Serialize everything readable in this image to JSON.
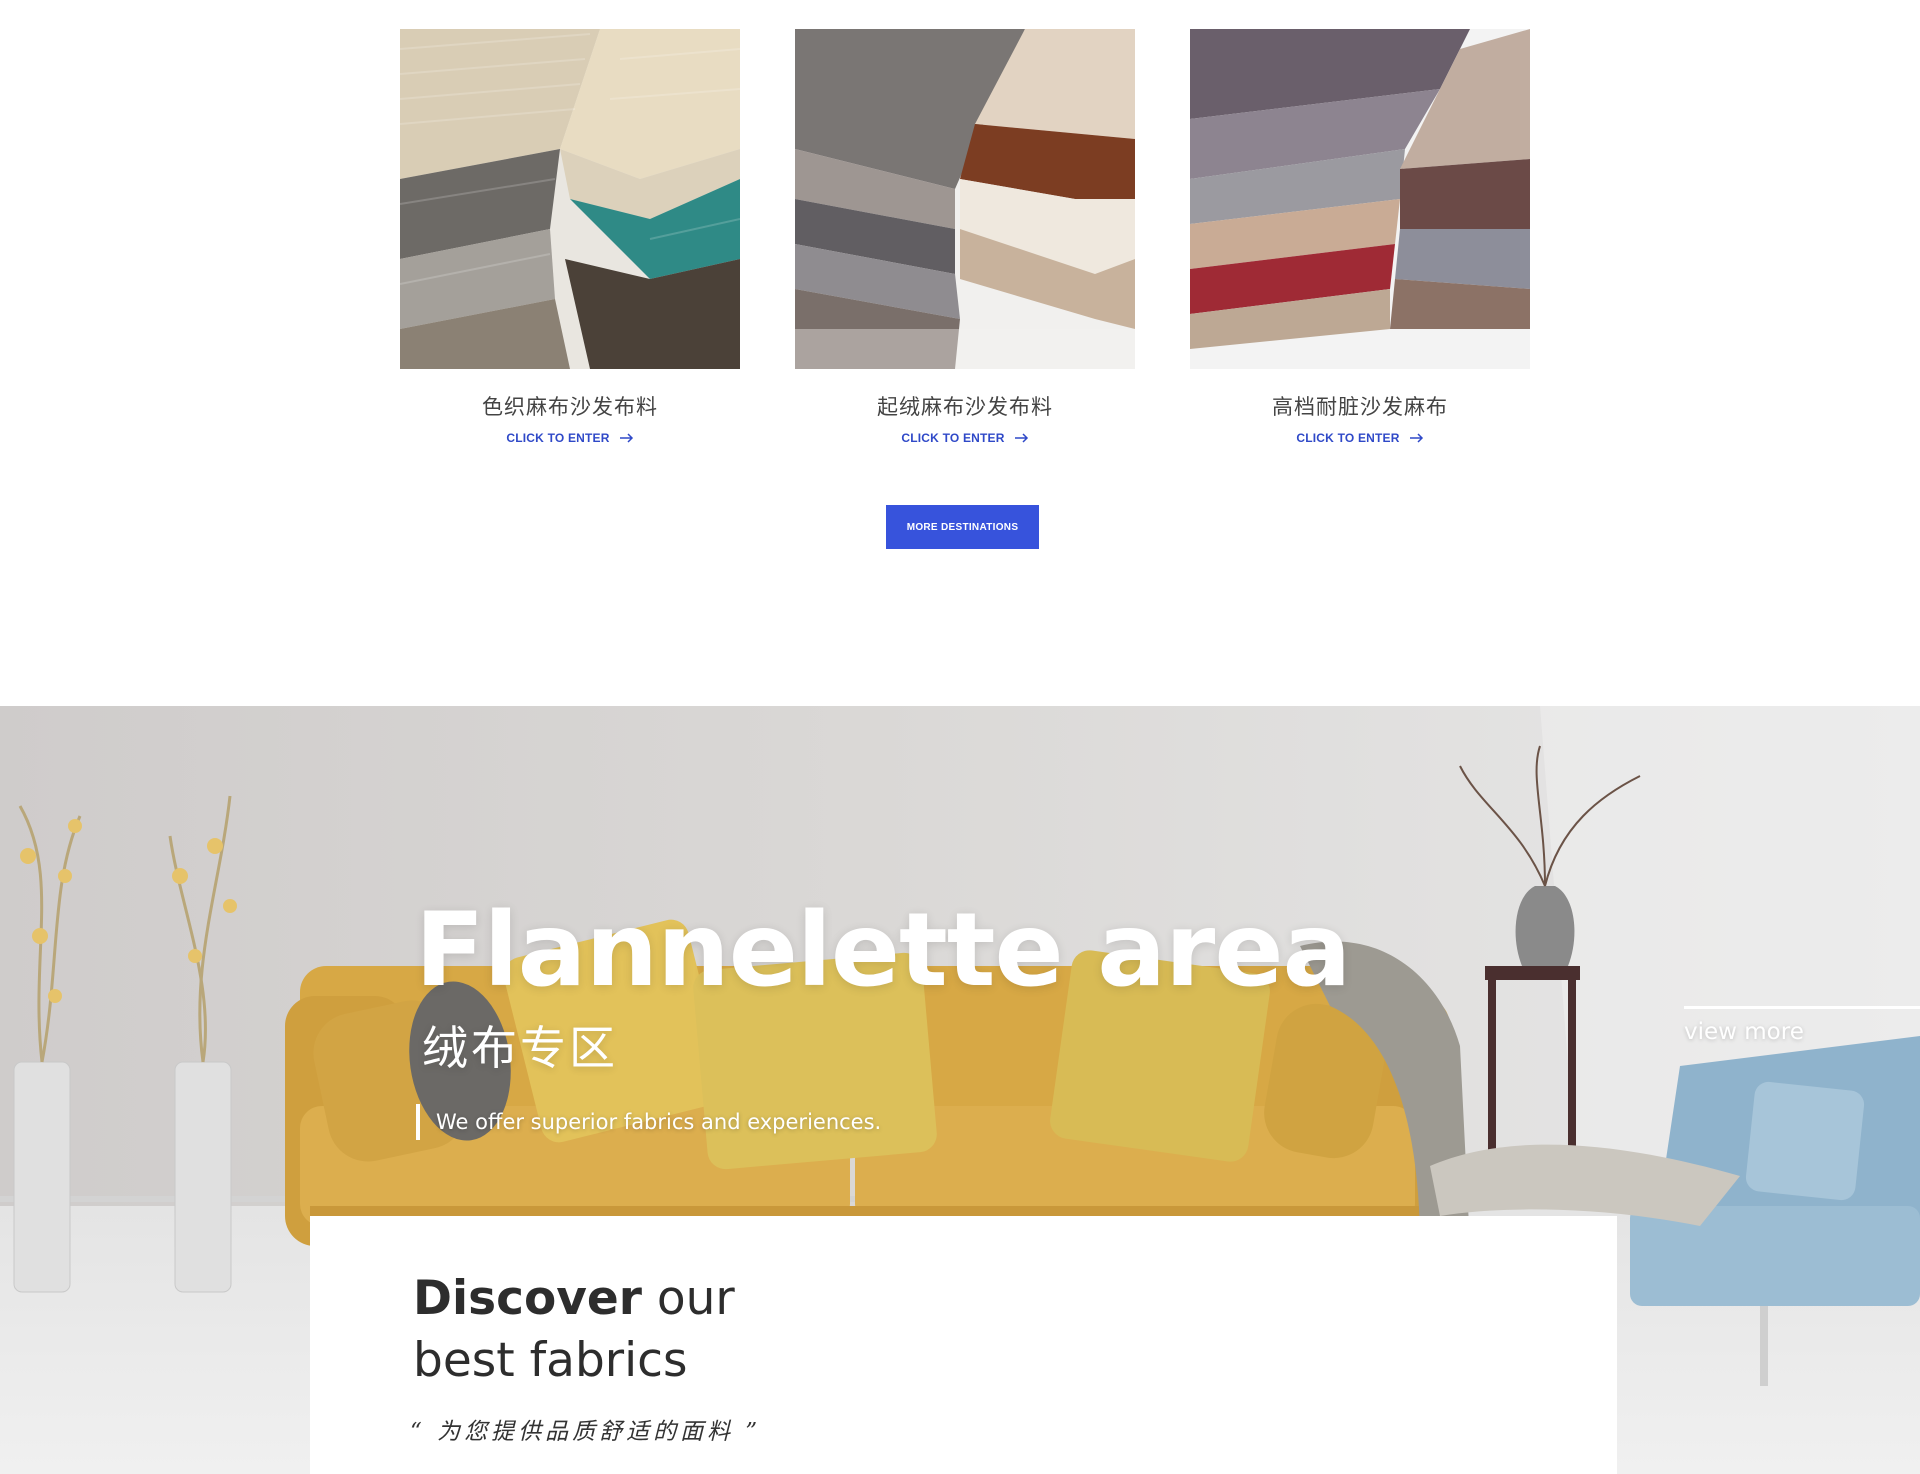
{
  "products": [
    {
      "title": "色织麻布沙发布料",
      "link_label": "CLICK TO ENTER",
      "image": "woven-linen-fabric-stack"
    },
    {
      "title": "起绒麻布沙发布料",
      "link_label": "CLICK TO ENTER",
      "image": "brushed-linen-fabric-stack"
    },
    {
      "title": "高档耐脏沙发麻布",
      "link_label": "CLICK TO ENTER",
      "image": "premium-linen-fabric-stack"
    }
  ],
  "more_button": "MORE DESTINATIONS",
  "banner": {
    "title": "Flannelette area",
    "subtitle": "绒布专区",
    "tagline": "We offer superior fabrics and experiences.",
    "view_more": "view more"
  },
  "discover": {
    "heading_bold": "Discover",
    "heading_rest": " our best fabrics",
    "quote": "“ 为您提供品质舒适的面料 ”"
  },
  "colors": {
    "accent": "#3753dc",
    "link": "#2f49c8",
    "sofa": "#d9ad4a",
    "chair": "#8fb3cc"
  }
}
